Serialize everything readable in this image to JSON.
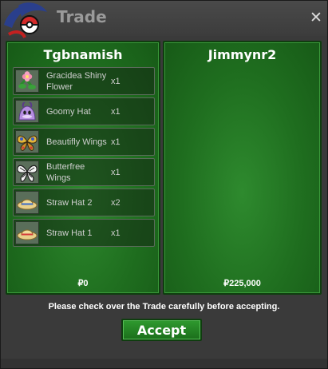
{
  "window": {
    "title": "Trade",
    "close_icon": "close-icon",
    "logo_icon": "pokeball-logo-icon"
  },
  "left_player": {
    "name": "Tgbnamish",
    "money": "₽0",
    "items": [
      {
        "name": "Gracidea Shiny Flower",
        "qty": "x1",
        "icon": "gracidea-flower-icon"
      },
      {
        "name": "Goomy Hat",
        "qty": "x1",
        "icon": "goomy-hat-icon"
      },
      {
        "name": "Beautifly Wings",
        "qty": "x1",
        "icon": "beautifly-wings-icon"
      },
      {
        "name": "Butterfree Wings",
        "qty": "x1",
        "icon": "butterfree-wings-icon"
      },
      {
        "name": "Straw Hat 2",
        "qty": "x2",
        "icon": "straw-hat-icon"
      },
      {
        "name": "Straw Hat 1",
        "qty": "x1",
        "icon": "straw-hat-red-icon"
      }
    ]
  },
  "right_player": {
    "name": "Jimmynr2",
    "money": "₽225,000",
    "items": []
  },
  "notice": "Please check over the Trade carefully before accepting.",
  "accept_label": "Accept",
  "colors": {
    "panel_green": "#1f6e1f",
    "window_gray": "#3a3a3a",
    "title_gray": "#9a9a9a"
  }
}
